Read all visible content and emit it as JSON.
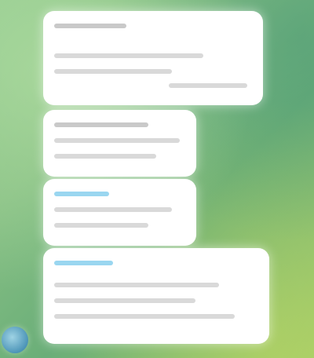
{
  "chat": {
    "messages": [
      {
        "text": ""
      },
      {
        "text": ""
      },
      {
        "text": ""
      },
      {
        "text": ""
      }
    ]
  },
  "colors": {
    "bubble": "#ffffff",
    "wallpaper_start": "#8fc88d",
    "wallpaper_end": "#9fca6d",
    "link_blue": "#9ad6f0"
  },
  "icons": {
    "avatar": "user-avatar-icon"
  }
}
